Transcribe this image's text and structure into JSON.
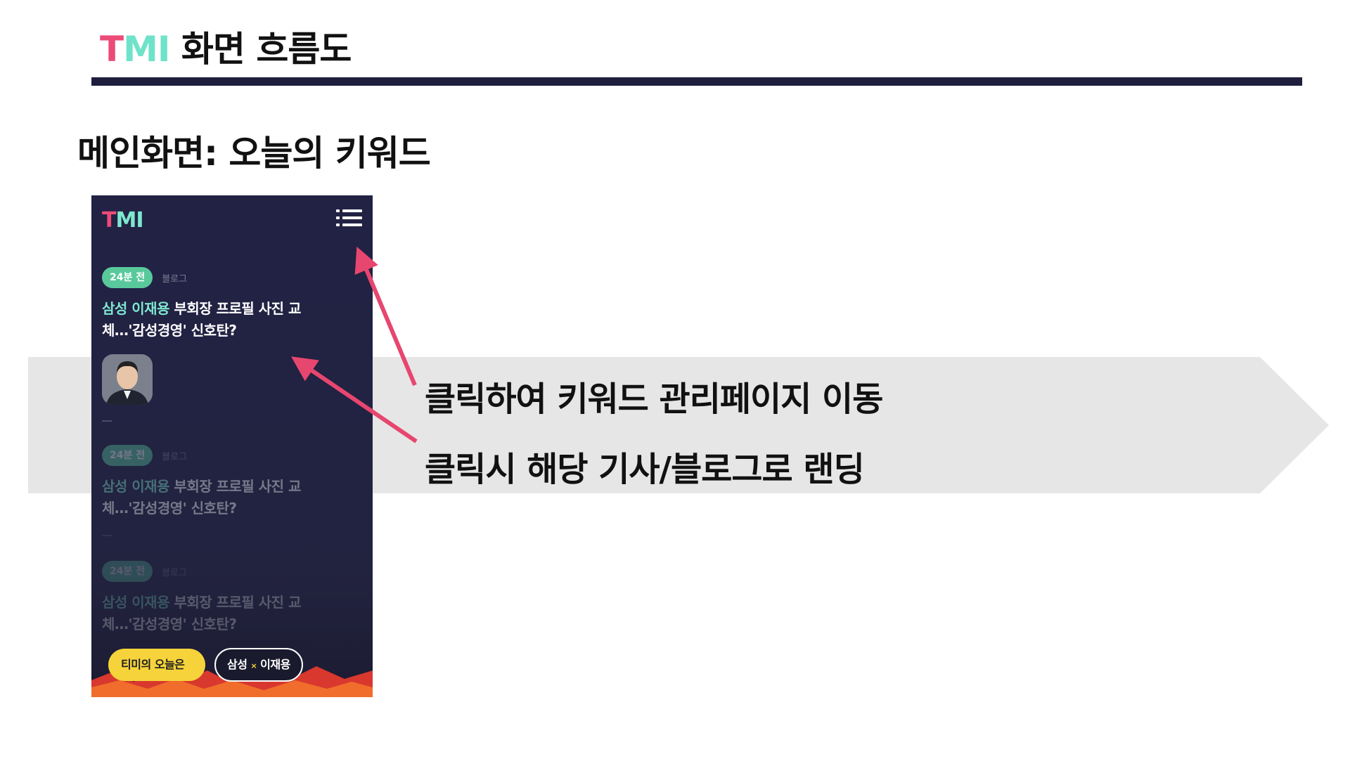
{
  "slide": {
    "title_logo": {
      "t": "T",
      "m": "M",
      "i": "I"
    },
    "title_text": "화면 흐름도",
    "section_title": "메인화면: 오늘의 키워드",
    "captions": [
      "클릭하여 키워드 관리페이지 이동",
      "클릭시 해당 기사/블로그로 랜딩"
    ]
  },
  "phone": {
    "logo": {
      "t": "T",
      "m": "M",
      "i": "I"
    },
    "menu_icon": "hamburger-list-icon",
    "cards": [
      {
        "time": "24분 전",
        "source": "블로그",
        "keyword": "삼성 이재용",
        "headline_line1": " 부회장 프로필 사진 교",
        "headline_line2": "체…'감성경영' 신호탄?",
        "thumbnail": "person-photo"
      },
      {
        "time": "24분 전",
        "source": "블로그",
        "keyword": "삼성 이재용",
        "headline_line1": " 부회장 프로필 사진 교",
        "headline_line2": "체…'감성경영' 신호탄?"
      },
      {
        "time": "24분 전",
        "source": "블로그",
        "keyword": "삼성 이재용",
        "headline_line1": " 부회장 프로필 사진 교",
        "headline_line2": "체…'감성경영' 신호탄?"
      }
    ],
    "bottom_buttons": {
      "today_label": "티미의 오늘은",
      "keyword_a": "삼성",
      "keyword_sep": "×",
      "keyword_b": "이재용"
    }
  },
  "colors": {
    "brand_pink": "#ec4a77",
    "brand_mint": "#6fe3c9",
    "navy": "#1e1f3f",
    "arrow": "#e7466f",
    "band_gray": "#e6e6e6",
    "button_yellow": "#f6d33a"
  }
}
